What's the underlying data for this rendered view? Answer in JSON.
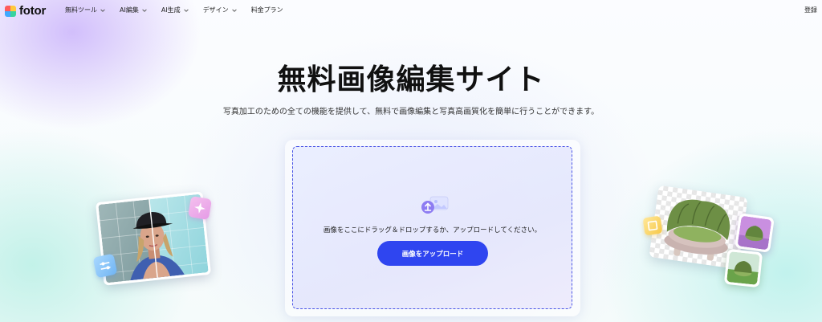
{
  "brand": {
    "name": "fotor",
    "colors": {
      "red": "#ff5b5b",
      "yellow": "#ffc83d",
      "blue": "#3fa9ff",
      "green": "#38d39f"
    }
  },
  "nav": {
    "items": [
      {
        "label": "無料ツール",
        "icon": "chevron-down-icon"
      },
      {
        "label": "AI編集",
        "icon": "chevron-down-icon"
      },
      {
        "label": "AI生成",
        "icon": "chevron-down-icon"
      },
      {
        "label": "デザイン",
        "icon": "chevron-down-icon"
      },
      {
        "label": "料金プラン"
      }
    ],
    "login_label": "登録"
  },
  "hero": {
    "title": "無料画像編集サイト",
    "subtitle": "写真加工のための全ての機能を提供して、無料で画像編集と写真高画質化を簡単に行うことができます。"
  },
  "upload": {
    "icon": "image-upload-icon",
    "instructions": "画像をここにドラッグ＆ドロップするか、アップロードしてください。",
    "button_label": "画像をアップロード",
    "accent_color": "#2f45f0",
    "border_color": "#4a55e6"
  },
  "illustrations": {
    "left": {
      "photo": "woman-portrait-enhance",
      "badges": [
        "sparkle-icon",
        "sliders-icon"
      ]
    },
    "right": {
      "photo": "green-armchair-background-removal",
      "badges": [
        "crop-icon"
      ]
    }
  }
}
